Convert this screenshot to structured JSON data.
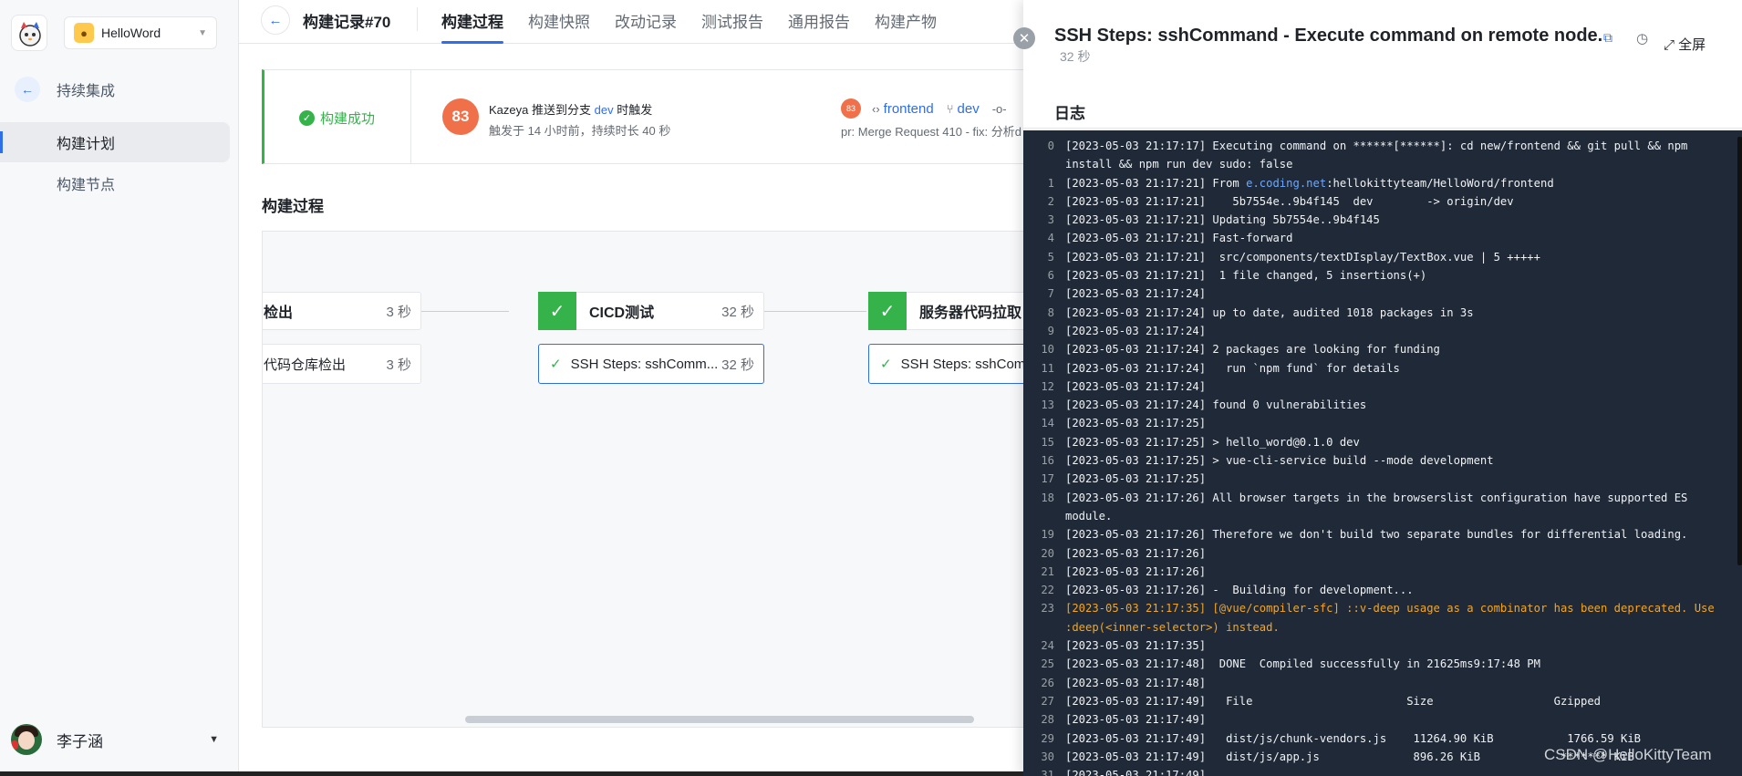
{
  "sidebar": {
    "project_name": "HelloWord",
    "section_label": "持续集成",
    "items": [
      {
        "label": "构建计划",
        "active": true
      },
      {
        "label": "构建节点",
        "active": false
      }
    ],
    "user_name": "李子涵"
  },
  "topbar": {
    "title": "构建记录#70",
    "tabs": [
      "构建过程",
      "构建快照",
      "改动记录",
      "测试报告",
      "通用报告",
      "构建产物"
    ]
  },
  "build_info": {
    "status": "构建成功",
    "number": "83",
    "trigger_prefix": "Kazeya 推送到分支",
    "trigger_branch": "dev",
    "trigger_suffix": "时触发",
    "trigger_time": "触发于 14 小时前，持续时长 40 秒",
    "mr_badge": "83",
    "repo": "frontend",
    "branch": "dev",
    "pr_text": "pr: Merge Request 410 - fix: 分析d"
  },
  "pipeline": {
    "title": "构建过程",
    "stages": [
      {
        "name": "检出",
        "duration": "3 秒",
        "step": "代码仓库检出",
        "step_duration": "3 秒"
      },
      {
        "name": "CICD测试",
        "duration": "32 秒",
        "step": "SSH Steps: sshComm...",
        "step_duration": "32 秒"
      },
      {
        "name": "服务器代码拉取",
        "duration": "",
        "step": "SSH Steps: sshComm",
        "step_duration": ""
      }
    ]
  },
  "panel": {
    "title": "SSH Steps: sshCommand - Execute command on remote node.",
    "duration": "32 秒",
    "fullscreen_label": "全屏",
    "log_tab": "日志",
    "log_lines": [
      {
        "n": "0",
        "t": "[2023-05-03 21:17:17] Executing command on ******[******]: cd new/frontend && git pull && npm install && npm run dev sudo: false"
      },
      {
        "n": "1",
        "t": "[2023-05-03 21:17:21] From ",
        "link": "e.coding.net",
        "rest": ":hellokittyteam/HelloWord/frontend"
      },
      {
        "n": "2",
        "t": "[2023-05-03 21:17:21]    5b7554e..9b4f145  dev        -> origin/dev"
      },
      {
        "n": "3",
        "t": "[2023-05-03 21:17:21] Updating 5b7554e..9b4f145"
      },
      {
        "n": "4",
        "t": "[2023-05-03 21:17:21] Fast-forward"
      },
      {
        "n": "5",
        "t": "[2023-05-03 21:17:21]  src/components/textDIsplay/TextBox.vue | 5 +++++"
      },
      {
        "n": "6",
        "t": "[2023-05-03 21:17:21]  1 file changed, 5 insertions(+)"
      },
      {
        "n": "7",
        "t": "[2023-05-03 21:17:24]"
      },
      {
        "n": "8",
        "t": "[2023-05-03 21:17:24] up to date, audited 1018 packages in 3s"
      },
      {
        "n": "9",
        "t": "[2023-05-03 21:17:24]"
      },
      {
        "n": "10",
        "t": "[2023-05-03 21:17:24] 2 packages are looking for funding"
      },
      {
        "n": "11",
        "t": "[2023-05-03 21:17:24]   run `npm fund` for details"
      },
      {
        "n": "12",
        "t": "[2023-05-03 21:17:24]"
      },
      {
        "n": "13",
        "t": "[2023-05-03 21:17:24] found 0 vulnerabilities"
      },
      {
        "n": "14",
        "t": "[2023-05-03 21:17:25]"
      },
      {
        "n": "15",
        "t": "[2023-05-03 21:17:25] > hello_word@0.1.0 dev"
      },
      {
        "n": "16",
        "t": "[2023-05-03 21:17:25] > vue-cli-service build --mode development"
      },
      {
        "n": "17",
        "t": "[2023-05-03 21:17:25]"
      },
      {
        "n": "18",
        "t": "[2023-05-03 21:17:26] All browser targets in the browserslist configuration have supported ES module."
      },
      {
        "n": "19",
        "t": "[2023-05-03 21:17:26] Therefore we don't build two separate bundles for differential loading."
      },
      {
        "n": "20",
        "t": "[2023-05-03 21:17:26]"
      },
      {
        "n": "21",
        "t": "[2023-05-03 21:17:26]"
      },
      {
        "n": "22",
        "t": "[2023-05-03 21:17:26] -  Building for development..."
      },
      {
        "n": "23",
        "t": "[2023-05-03 21:17:35] [@vue/compiler-sfc] ::v-deep usage as a combinator has been deprecated. Use :deep(<inner-selector>) instead.",
        "warn": true
      },
      {
        "n": "24",
        "t": "[2023-05-03 21:17:35]"
      },
      {
        "n": "25",
        "t": "[2023-05-03 21:17:48]  DONE  Compiled successfully in 21625ms9:17:48 PM"
      },
      {
        "n": "26",
        "t": "[2023-05-03 21:17:48]"
      },
      {
        "n": "27",
        "t": "[2023-05-03 21:17:49]   File                       Size                  Gzipped"
      },
      {
        "n": "28",
        "t": "[2023-05-03 21:17:49]"
      },
      {
        "n": "29",
        "t": "[2023-05-03 21:17:49]   dist/js/chunk-vendors.js    11264.90 KiB           1766.59 KiB"
      },
      {
        "n": "30",
        "t": "[2023-05-03 21:17:49]   dist/js/app.js              896.26 KiB            ******* KiB"
      },
      {
        "n": "31",
        "t": "[2023-05-03 21:17:49]"
      }
    ]
  },
  "watermark": "CSDN @HelloKittyTeam",
  "colors": {
    "accent": "#2f6eeb",
    "success": "#35b24a",
    "badge": "#f0704a",
    "log_bg": "#1f2937",
    "warn": "#f5a623"
  }
}
